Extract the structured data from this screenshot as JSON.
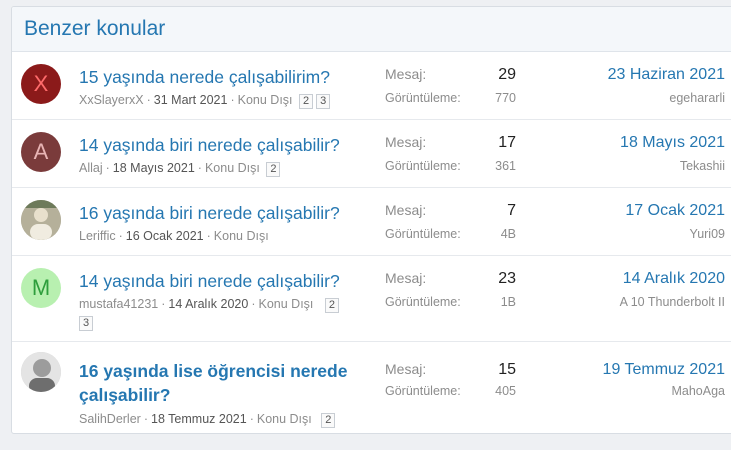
{
  "header": {
    "title": "Benzer konular"
  },
  "threads": [
    {
      "title": "15 yaşında nerede çalışabilirim?",
      "author": "XxSlayerxX",
      "date": "31 Mart 2021",
      "forum": "Konu Dışı",
      "pages": [
        "2",
        "3"
      ],
      "replies_label": "Mesaj:",
      "replies": "29",
      "views_label": "Görüntüleme:",
      "views": "770",
      "last_date": "23 Haziran 2021",
      "last_user": "egehararli",
      "avatar_letter": "X",
      "avatar_bg": "#8b1a1a",
      "avatar_fg": "#ff6b6b"
    },
    {
      "title": "14 yaşında biri nerede çalışabilir?",
      "author": "Allaj",
      "date": "18 Mayıs 2021",
      "forum": "Konu Dışı",
      "pages": [
        "2"
      ],
      "replies_label": "Mesaj:",
      "replies": "17",
      "views_label": "Görüntüleme:",
      "views": "361",
      "last_date": "18 Mayıs 2021",
      "last_user": "Tekashii",
      "avatar_letter": "A",
      "avatar_bg": "#7a3b3b",
      "avatar_fg": "#e8b4b4"
    },
    {
      "title": "16 yaşında biri nerede çalışabilir?",
      "author": "Leriffic",
      "date": "16 Ocak 2021",
      "forum": "Konu Dışı",
      "pages": [],
      "replies_label": "Mesaj:",
      "replies": "7",
      "views_label": "Görüntüleme:",
      "views": "4B",
      "last_date": "17 Ocak 2021",
      "last_user": "Yuri09",
      "avatar_letter": "",
      "avatar_bg": "#9a9a88",
      "avatar_fg": "#ffffff"
    },
    {
      "title": "14 yaşında biri nerede çalışabilir?",
      "author": "mustafa41231",
      "date": "14 Aralık 2020",
      "forum": "Konu Dışı",
      "pages": [
        "2",
        "3"
      ],
      "replies_label": "Mesaj:",
      "replies": "23",
      "views_label": "Görüntüleme:",
      "views": "1B",
      "last_date": "14 Aralık 2020",
      "last_user": "A 10 Thunderbolt II",
      "avatar_letter": "M",
      "avatar_bg": "#b8f0b0",
      "avatar_fg": "#2e9e3c"
    },
    {
      "title": "16 yaşında lise öğrencisi nerede çalışabilir?",
      "author": "SalihDerler",
      "date": "18 Temmuz 2021",
      "forum": "Konu Dışı",
      "pages": [
        "2"
      ],
      "replies_label": "Mesaj:",
      "replies": "15",
      "views_label": "Görüntüleme:",
      "views": "405",
      "last_date": "19 Temmuz 2021",
      "last_user": "MahoAga",
      "avatar_letter": "",
      "avatar_bg": "#c8c8c8",
      "avatar_fg": "#ffffff"
    }
  ],
  "icons": {
    "thread_avatar": "user-avatar-icon"
  }
}
